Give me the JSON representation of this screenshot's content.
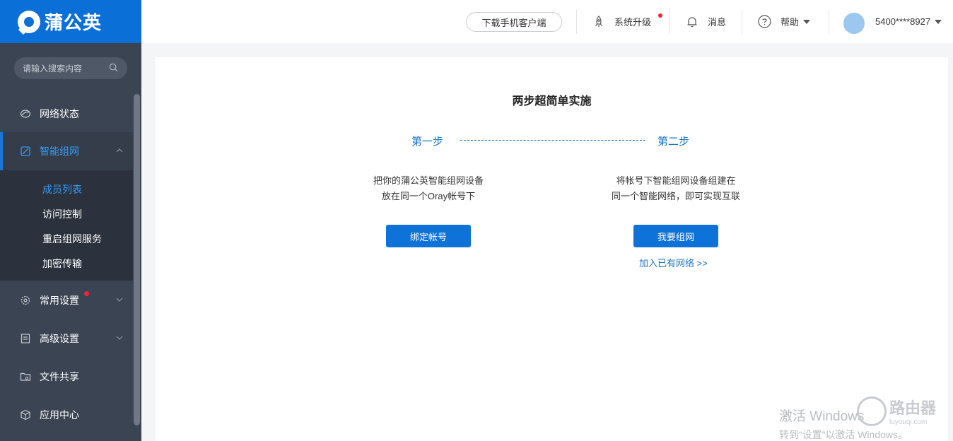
{
  "app": {
    "logo_text": "蒲公英"
  },
  "sidebar": {
    "search_placeholder": "请输入搜索内容",
    "items": [
      {
        "label": "网络状态",
        "icon": "network-icon"
      },
      {
        "label": "智能组网",
        "icon": "smart-network-icon",
        "active": true
      },
      {
        "label": "常用设置",
        "icon": "gear-icon",
        "has_notification_dot": true
      },
      {
        "label": "高级设置",
        "icon": "advanced-settings-icon"
      },
      {
        "label": "文件共享",
        "icon": "folder-icon"
      },
      {
        "label": "应用中心",
        "icon": "cube-icon"
      }
    ],
    "submenu": [
      {
        "label": "成员列表",
        "active": true
      },
      {
        "label": "访问控制"
      },
      {
        "label": "重启组网服务"
      },
      {
        "label": "加密传输"
      }
    ]
  },
  "header": {
    "download_label": "下载手机客户端",
    "upgrade_label": "系统升级",
    "messages_label": "消息",
    "help_label": "帮助",
    "username": "5400****8927"
  },
  "main": {
    "title": "两步超简单实施",
    "step1": {
      "label": "第一步",
      "desc_line1": "把你的蒲公英智能组网设备",
      "desc_line2": "放在同一个Oray帐号下",
      "button": "绑定帐号"
    },
    "step2": {
      "label": "第二步",
      "desc_line1": "将帐号下智能组网设备组建在",
      "desc_line2": "同一个智能网络，即可实现互联",
      "button": "我要组网",
      "link": "加入已有网络 >>"
    }
  },
  "watermark": {
    "line1": "激活 Windows",
    "line2": "转到“设置”以激活 Windows。",
    "brand": "路由器",
    "brand_url": "luyouqi.com"
  },
  "colors": {
    "brand_blue": "#0a6fd6",
    "sidebar_bg": "#3b4452",
    "active_text": "#3a98f0",
    "notification_red": "#f0243c"
  }
}
